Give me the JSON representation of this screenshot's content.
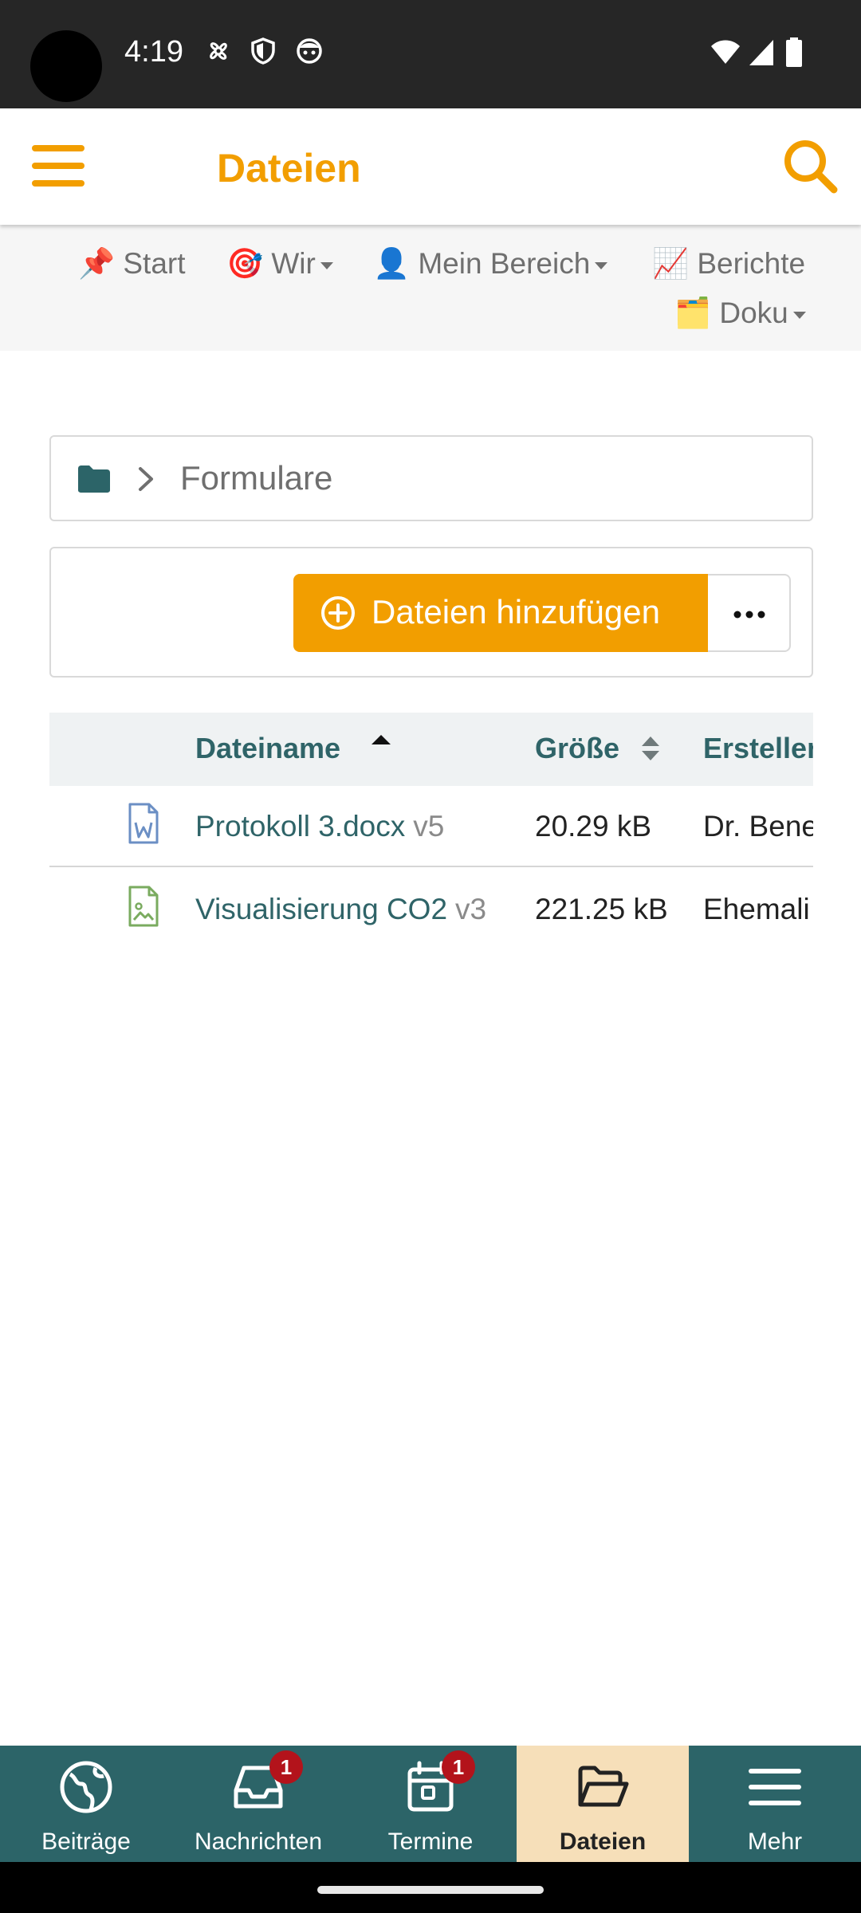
{
  "status_bar": {
    "time": "4:19"
  },
  "app_bar": {
    "title": "Dateien"
  },
  "nav_menu": {
    "items": [
      {
        "emoji": "📌",
        "label": "Start",
        "has_dropdown": false
      },
      {
        "emoji": "🎯",
        "label": "Wir",
        "has_dropdown": true
      },
      {
        "emoji": "👤",
        "label": "Mein Bereich",
        "has_dropdown": true
      },
      {
        "emoji": "📈",
        "label": "Berichte",
        "has_dropdown": false
      },
      {
        "emoji": "🗂️",
        "label": "Doku",
        "has_dropdown": true
      }
    ]
  },
  "breadcrumb": {
    "current": "Formulare"
  },
  "toolbar": {
    "add_label": "Dateien hinzufügen"
  },
  "table": {
    "columns": {
      "name": "Dateiname",
      "size": "Größe",
      "creator": "Ersteller"
    },
    "rows": [
      {
        "icon": "word-file-icon",
        "name": "Protokoll 3.docx",
        "version": "v5",
        "size": "20.29 kB",
        "creator": "Dr. Bene"
      },
      {
        "icon": "image-file-icon",
        "name": "Visualisierung CO2",
        "version": "v3",
        "size": "221.25 kB",
        "creator": "Ehemali"
      }
    ]
  },
  "bottom_nav": {
    "items": [
      {
        "label": "Beiträge",
        "icon": "globe-icon",
        "badge": null,
        "active": false
      },
      {
        "label": "Nachrichten",
        "icon": "inbox-icon",
        "badge": "1",
        "active": false
      },
      {
        "label": "Termine",
        "icon": "calendar-icon",
        "badge": "1",
        "active": false
      },
      {
        "label": "Dateien",
        "icon": "folder-open-icon",
        "badge": null,
        "active": true
      },
      {
        "label": "Mehr",
        "icon": "menu-icon",
        "badge": null,
        "active": false
      }
    ]
  },
  "colors": {
    "accent": "#f29e00",
    "primary": "#2c6468",
    "badge": "#b3131b"
  }
}
